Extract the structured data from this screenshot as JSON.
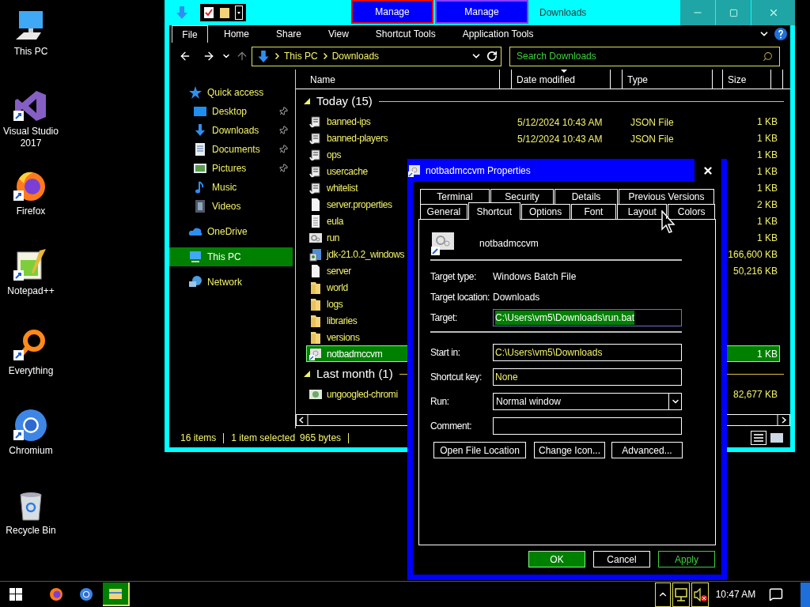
{
  "desktop_icons": [
    {
      "label": "This PC",
      "kind": "pc",
      "shortcut": false
    },
    {
      "label": "Visual Studio 2017",
      "kind": "vs",
      "shortcut": true
    },
    {
      "label": "Firefox",
      "kind": "firefox",
      "shortcut": true
    },
    {
      "label": "Notepad++",
      "kind": "notepad",
      "shortcut": true
    },
    {
      "label": "Everything",
      "kind": "everything",
      "shortcut": true
    },
    {
      "label": "Chromium",
      "kind": "chromium",
      "shortcut": true
    },
    {
      "label": "Recycle Bin",
      "kind": "bin",
      "shortcut": false
    }
  ],
  "explorer": {
    "context_tabs": [
      {
        "label": "Manage",
        "color": "#e01010"
      },
      {
        "label": "Manage",
        "color": "#8a3cff"
      }
    ],
    "title": "Downloads",
    "ribbon_tabs": [
      {
        "label": "File",
        "kind": "file"
      },
      {
        "label": "Home",
        "kind": "tab"
      },
      {
        "label": "Share",
        "kind": "tab"
      },
      {
        "label": "View",
        "kind": "tab"
      },
      {
        "label": "Shortcut Tools",
        "kind": "tab"
      },
      {
        "label": "Application Tools",
        "kind": "tab"
      }
    ],
    "address": [
      "This PC",
      "Downloads"
    ],
    "search": {
      "placeholder": "Search Downloads"
    },
    "nav": [
      {
        "label": "Quick access",
        "kind": "star",
        "selected": false,
        "children": [
          {
            "label": "Desktop",
            "kind": "desktop",
            "pinned": true,
            "selected": false
          },
          {
            "label": "Downloads",
            "kind": "download",
            "pinned": true,
            "selected": false
          },
          {
            "label": "Documents",
            "kind": "documents",
            "pinned": true,
            "selected": false
          },
          {
            "label": "Pictures",
            "kind": "pictures",
            "pinned": true,
            "selected": false
          },
          {
            "label": "Music",
            "kind": "music",
            "pinned": false,
            "selected": false
          },
          {
            "label": "Videos",
            "kind": "videos",
            "pinned": false,
            "selected": false
          }
        ]
      },
      {
        "label": "OneDrive",
        "kind": "cloud",
        "selected": false
      },
      {
        "label": "This PC",
        "kind": "pc",
        "selected": true
      },
      {
        "label": "Network",
        "kind": "network",
        "selected": false
      }
    ],
    "columns": [
      {
        "label": "Name",
        "sorted": false
      },
      {
        "label": "Date modified",
        "sorted": true
      },
      {
        "label": "Type",
        "sorted": false
      },
      {
        "label": "Size",
        "sorted": false
      }
    ],
    "groups": [
      {
        "label": "Today (15)",
        "expanded": true,
        "rows": [
          {
            "name": "banned-ips",
            "kind": "json",
            "date": "5/12/2024 10:43 AM",
            "type": "JSON File",
            "size": "1 KB",
            "selected": false
          },
          {
            "name": "banned-players",
            "kind": "json",
            "date": "5/12/2024 10:43 AM",
            "type": "JSON File",
            "size": "1 KB",
            "selected": false
          },
          {
            "name": "ops",
            "kind": "json",
            "size": "1 KB",
            "selected": false
          },
          {
            "name": "usercache",
            "kind": "json",
            "size": "1 KB",
            "selected": false
          },
          {
            "name": "whitelist",
            "kind": "json",
            "size": "1 KB",
            "selected": false
          },
          {
            "name": "server.properties",
            "kind": "blank",
            "size": "2 KB",
            "selected": false
          },
          {
            "name": "eula",
            "kind": "text",
            "size": "1 KB",
            "selected": false
          },
          {
            "name": "run",
            "kind": "batch",
            "size": "1 KB",
            "selected": false
          },
          {
            "name": "jdk-21.0.2_windows",
            "kind": "installer",
            "size": "166,600 KB",
            "selected": false
          },
          {
            "name": "server",
            "kind": "blank",
            "size": "50,216 KB",
            "selected": false
          },
          {
            "name": "world",
            "kind": "folder",
            "selected": false
          },
          {
            "name": "logs",
            "kind": "folder",
            "selected": false
          },
          {
            "name": "libraries",
            "kind": "folder",
            "selected": false
          },
          {
            "name": "versions",
            "kind": "folder",
            "selected": false
          },
          {
            "name": "notbadmccvm",
            "kind": "shortcut",
            "size": "1 KB",
            "selected": true
          }
        ]
      },
      {
        "label": "Last month (1)",
        "expanded": true,
        "rows": [
          {
            "name": "ungoogled-chromi",
            "kind": "app",
            "size": "82,677 KB",
            "selected": false
          }
        ]
      }
    ],
    "status": {
      "count": "16 items",
      "selection": "1 item selected",
      "bytes": "965 bytes"
    }
  },
  "dialog": {
    "title": "notbadmccvm Properties",
    "tab_rows": [
      [
        {
          "label": "Terminal",
          "selected": false
        },
        {
          "label": "Security",
          "selected": false
        },
        {
          "label": "Details",
          "selected": false
        },
        {
          "label": "Previous Versions",
          "selected": false
        }
      ],
      [
        {
          "label": "General",
          "selected": false
        },
        {
          "label": "Shortcut",
          "selected": true
        },
        {
          "label": "Options",
          "selected": false
        },
        {
          "label": "Font",
          "selected": false
        },
        {
          "label": "Layout",
          "selected": false
        },
        {
          "label": "Colors",
          "selected": false
        }
      ]
    ],
    "name": "notbadmccvm",
    "info": [
      {
        "label": "Target type:",
        "value": "Windows Batch File"
      },
      {
        "label": "Target location:",
        "value": "Downloads"
      }
    ],
    "target": {
      "label": "Target:",
      "value": "C:\\Users\\vm5\\Downloads\\run.bat",
      "focused": true
    },
    "fields": [
      {
        "label": "Start in:",
        "value": "C:\\Users\\vm5\\Downloads",
        "kind": "text"
      },
      {
        "label": "Shortcut key:",
        "value": "None",
        "kind": "text"
      },
      {
        "label": "Run:",
        "value": "Normal window",
        "kind": "select"
      },
      {
        "label": "Comment:",
        "kind": "text"
      }
    ],
    "actions": [
      "Open File Location",
      "Change Icon...",
      "Advanced..."
    ],
    "buttons": [
      {
        "label": "OK",
        "kind": "default"
      },
      {
        "label": "Cancel",
        "kind": "normal"
      },
      {
        "label": "Apply",
        "kind": "disabled"
      }
    ]
  },
  "taskbar": {
    "apps": [
      {
        "kind": "firefox",
        "active": false
      },
      {
        "kind": "chromium",
        "active": false
      },
      {
        "kind": "explorer",
        "active": true
      }
    ],
    "volume_muted": true,
    "clock": "10:47 AM"
  }
}
